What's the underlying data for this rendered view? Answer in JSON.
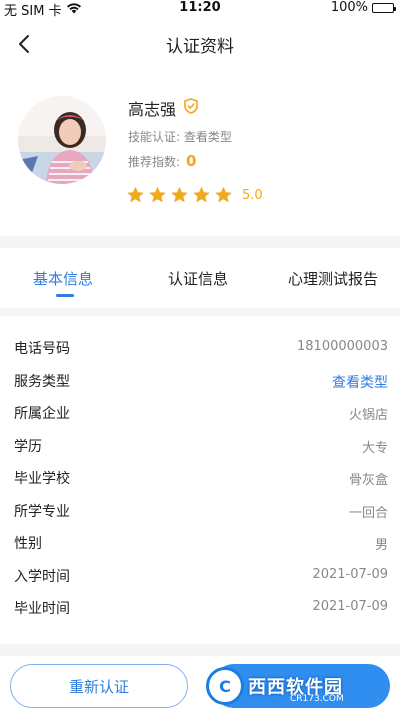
{
  "status_bar": {
    "carrier": "无 SIM 卡",
    "time": "11:20",
    "battery_percent": "100%",
    "battery_level": 1.0
  },
  "nav": {
    "title": "认证资料"
  },
  "profile": {
    "name": "高志强",
    "skill_label": "技能认证:",
    "skill_value": "查看类型",
    "recommend_label": "推荐指数:",
    "recommend_value": "0",
    "rating_value": 5.0,
    "rating_text": "5.0",
    "stars_filled": 5,
    "stars_total": 5
  },
  "tabs": [
    {
      "label": "基本信息",
      "active": true
    },
    {
      "label": "认证信息",
      "active": false
    },
    {
      "label": "心理测试报告",
      "active": false
    }
  ],
  "info_rows": [
    {
      "label": "电话号码",
      "value": "18100000003"
    },
    {
      "label": "服务类型",
      "value": "查看类型",
      "link": true
    },
    {
      "label": "所属企业",
      "value": "火锅店"
    },
    {
      "label": "学历",
      "value": "大专"
    },
    {
      "label": "毕业学校",
      "value": "骨灰盒"
    },
    {
      "label": "所学专业",
      "value": "一回合"
    },
    {
      "label": "性别",
      "value": "男"
    },
    {
      "label": "入学时间",
      "value": "2021-07-09"
    },
    {
      "label": "毕业时间",
      "value": "2021-07-09"
    }
  ],
  "actions": {
    "recertify_label": "重新认证"
  },
  "watermark": {
    "text": "西西软件园",
    "sub": "CR173.COM"
  },
  "colors": {
    "accent": "#2f7de1",
    "star": "#f2a81d",
    "muted": "#888888",
    "band": "#f4f5f7"
  }
}
